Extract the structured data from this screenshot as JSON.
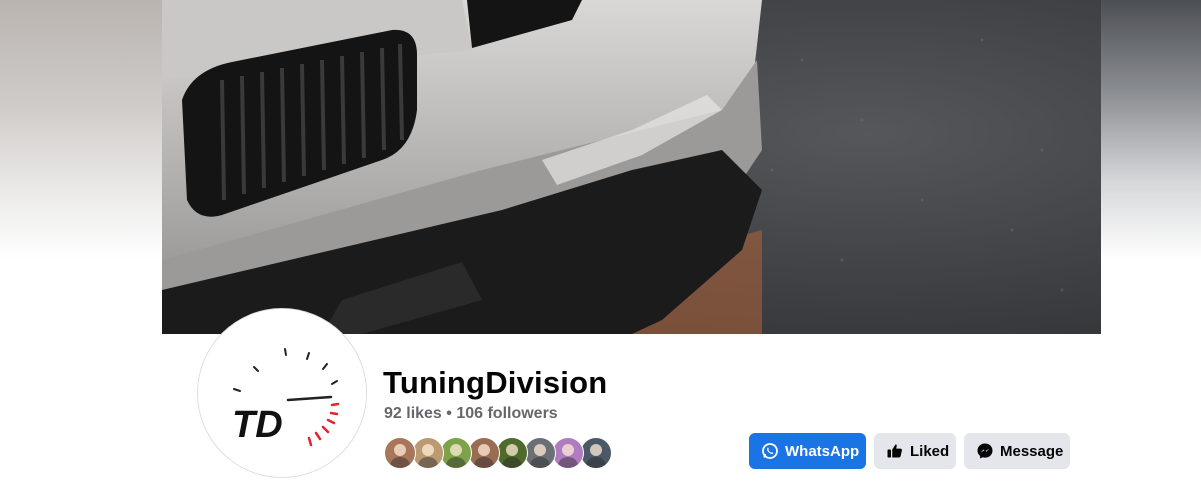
{
  "page": {
    "name": "TuningDivision",
    "stats": "92 likes • 106 followers",
    "logo_text": "TD"
  },
  "follower_avatars": [
    {
      "name": "follower-avatar-1",
      "color": "#a8765a"
    },
    {
      "name": "follower-avatar-2",
      "color": "#b99a73"
    },
    {
      "name": "follower-avatar-3",
      "color": "#7ea24a"
    },
    {
      "name": "follower-avatar-4",
      "color": "#9a6c52"
    },
    {
      "name": "follower-avatar-5",
      "color": "#4e6b2c"
    },
    {
      "name": "follower-avatar-6",
      "color": "#6c6f75"
    },
    {
      "name": "follower-avatar-7",
      "color": "#b07cc0"
    },
    {
      "name": "follower-avatar-8",
      "color": "#4a5868"
    }
  ],
  "actions": {
    "whatsapp_label": "WhatsApp",
    "liked_label": "Liked",
    "message_label": "Message"
  },
  "colors": {
    "primary": "#1b74e4",
    "secondary_button": "#e4e6eb",
    "text_primary": "#050505",
    "text_secondary": "#65676b",
    "logo_accent": "#e0262d"
  }
}
